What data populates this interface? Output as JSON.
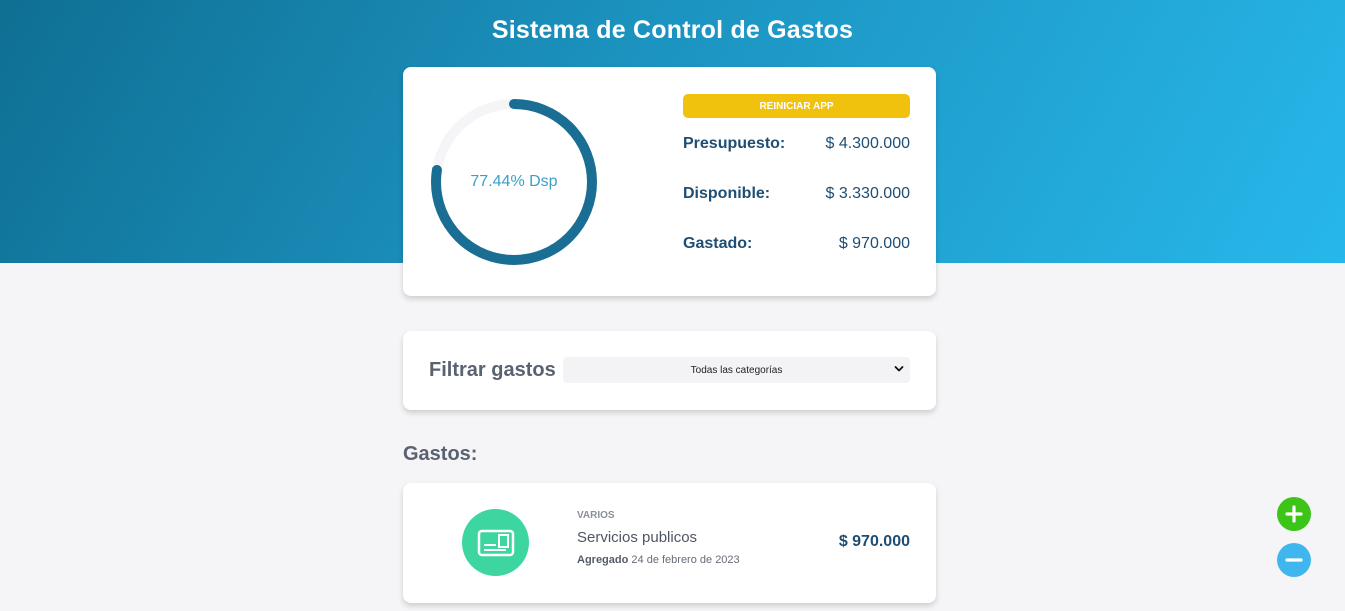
{
  "header": {
    "title": "Sistema de Control de Gastos"
  },
  "budget": {
    "progress_percent": 77.44,
    "progress_label": "77.44% Dsp",
    "reset_label": "REINICIAR APP",
    "rows": [
      {
        "label": "Presupuesto:",
        "value": "$ 4.300.000"
      },
      {
        "label": "Disponible:",
        "value": "$ 3.330.000"
      },
      {
        "label": "Gastado:",
        "value": "$ 970.000"
      }
    ],
    "colors": {
      "ring": "#1a6e93",
      "ring_track": "#f5f5f7",
      "reset": "#f0c20d"
    }
  },
  "filter": {
    "label": "Filtrar gastos",
    "selected": "Todas las categorías"
  },
  "expenses": {
    "title": "Gastos:",
    "items": [
      {
        "category": "VARIOS",
        "name": "Servicios publicos",
        "date_prefix": "Agregado",
        "date": "24 de febrero de 2023",
        "amount": "$ 970.000",
        "icon": "id-card-icon"
      }
    ]
  },
  "actions": {
    "add_icon": "plus-icon",
    "remove_icon": "minus-icon",
    "colors": {
      "add": "#3cc418",
      "remove": "#3fb6ee"
    }
  }
}
